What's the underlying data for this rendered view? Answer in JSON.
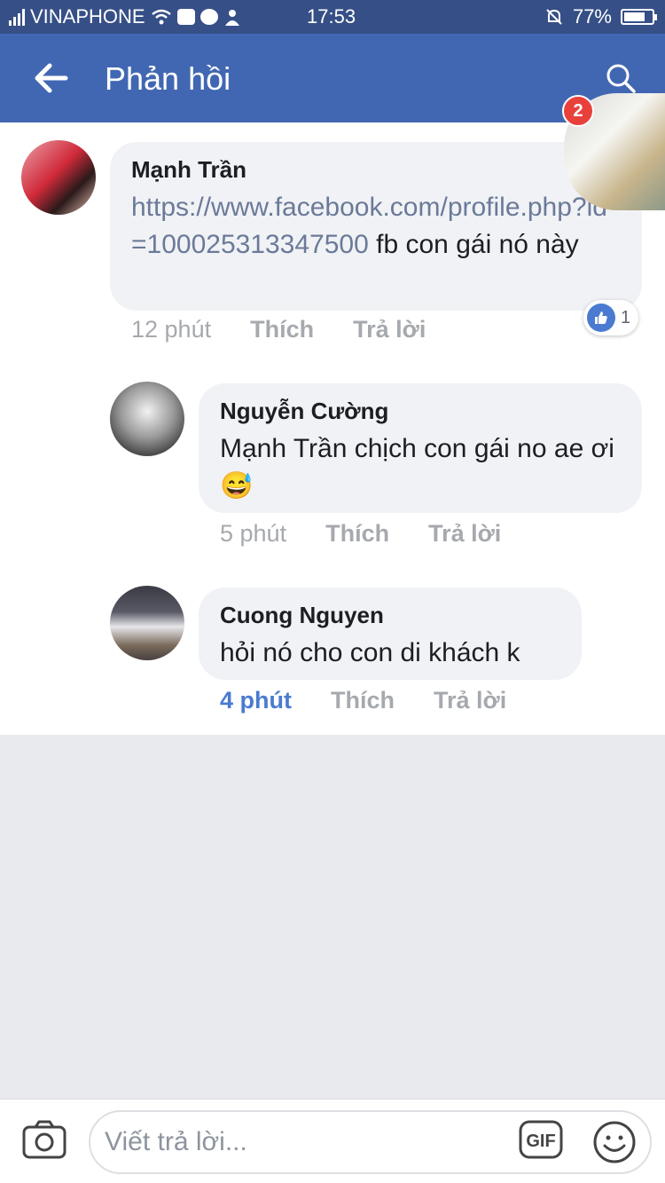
{
  "status_bar": {
    "carrier": "VINAPHONE",
    "time": "17:53",
    "battery": "77%",
    "battery_level": 0.77
  },
  "header": {
    "title": "Phản hồi",
    "back_icon": "arrow-left-icon",
    "search_icon": "search-icon"
  },
  "chathead": {
    "badge_count": "2"
  },
  "comments": [
    {
      "author": "Mạnh Trần",
      "link": "https://www.facebook.com/profile.php?id=100025313347500",
      "text": "fb con gái nó này",
      "time": "12 phút",
      "like_label": "Thích",
      "reply_label": "Trả lời",
      "reaction_count": "1"
    },
    {
      "author": "Nguyễn Cường",
      "text": "Mạnh Trần chịch con gái no ae ơi",
      "emoji": "😅",
      "time": "5 phút",
      "like_label": "Thích",
      "reply_label": "Trả lời"
    },
    {
      "author": "Cuong Nguyen",
      "text": "hỏi nó cho con di khách k",
      "time": "4 phút",
      "like_label": "Thích",
      "reply_label": "Trả lời"
    }
  ],
  "composer": {
    "placeholder": "Viết trả lời...",
    "gif_label": "GIF"
  }
}
